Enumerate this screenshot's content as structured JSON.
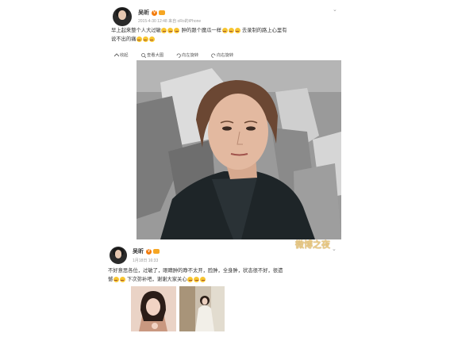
{
  "post1": {
    "username": "吴昕",
    "meta": "2015-4-30 12:48 来自 oRo的iPhone",
    "text_parts": [
      "早上起来整个人大过敏",
      "肿的跟个魔瓜一样",
      "去录制的路上心里有",
      "说不出的痛"
    ],
    "toolbar": {
      "collapse": "收起",
      "view_large": "查看大图",
      "rotate_left": "向左旋转",
      "rotate_right": "向右旋转"
    }
  },
  "post2": {
    "username": "吴昕",
    "meta": "1月18日 16:33",
    "text_line1": "不好意思各位，过敏了，眼睛肿的睁不太开，脸肿，全身肿，状态很不好，很遗",
    "text_line2_a": "憾",
    "text_line2_b": "下次弥补吧，谢谢大家关心"
  },
  "watermark": "微博之夜",
  "icons": [
    "verified-v-icon",
    "vip-crown-icon",
    "chevron-down-icon",
    "collapse-icon",
    "zoom-icon",
    "rotate-left-icon",
    "rotate-right-icon",
    "emoji-icon"
  ],
  "colors": {
    "verified": "#f47c0c",
    "emoji": "#f7c531",
    "watermark": "#e8c985"
  }
}
